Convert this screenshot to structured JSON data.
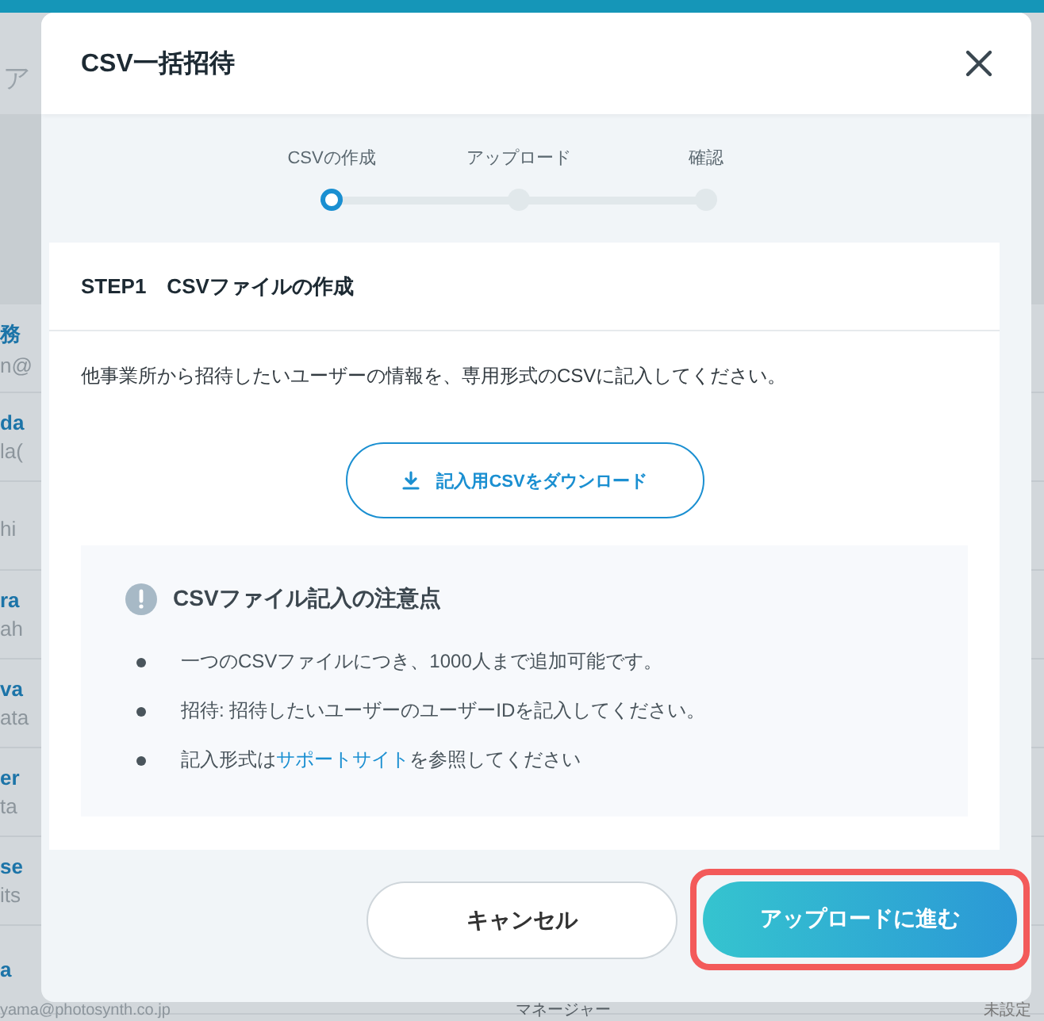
{
  "background": {
    "search_fragment": "ア",
    "rows": [
      {
        "name": "務",
        "email": "n@"
      },
      {
        "name": "da",
        "email": "la("
      },
      {
        "email": "hi"
      },
      {
        "name": "ra",
        "email": "ah"
      },
      {
        "name": "va",
        "email": "ata"
      },
      {
        "name": "er",
        "email": "ta"
      },
      {
        "name": "se",
        "email": "its"
      },
      {
        "name": "a"
      }
    ],
    "bottom_row": {
      "email": "yama@photosynth.co.jp",
      "role": "マネージャー",
      "status": "未設定"
    }
  },
  "modal": {
    "title": "CSV一括招待",
    "steps": [
      {
        "label": "CSVの作成",
        "selected": true
      },
      {
        "label": "アップロード",
        "selected": false
      },
      {
        "label": "確認",
        "selected": false
      }
    ],
    "card": {
      "heading": "STEP1　CSVファイルの作成",
      "description": "他事業所から招待したいユーザーの情報を、専用形式のCSVに記入してください。",
      "download_button": "記入用CSVをダウンロード",
      "notice": {
        "title": "CSVファイル記入の注意点",
        "items": [
          "一つのCSVファイルにつき、1000人まで追加可能です。",
          "招待: 招待したいユーザーのユーザーIDを記入してください。"
        ],
        "link_item": {
          "before": "記入形式は",
          "link": "サポートサイト",
          "after": "を参照してください"
        }
      }
    },
    "buttons": {
      "cancel": "キャンセル",
      "next": "アップロードに進む",
      "next_highlighted": true
    }
  }
}
